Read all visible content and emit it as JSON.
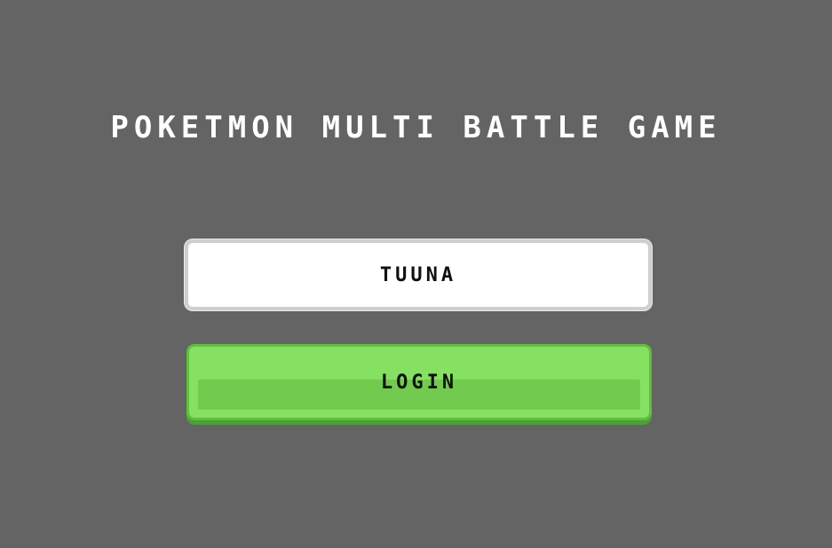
{
  "title": "POKETMON MULTI BATTLE GAME",
  "login_form": {
    "name_value": "TUUNA",
    "login_label": "LOGIN"
  },
  "colors": {
    "background": "#646464",
    "title_text": "#ffffff",
    "input_bg": "#ffffff",
    "input_border": "#cfcfcf",
    "button_green": "#86e062",
    "button_green_dark": "#72cb4f",
    "button_text": "#111111"
  }
}
